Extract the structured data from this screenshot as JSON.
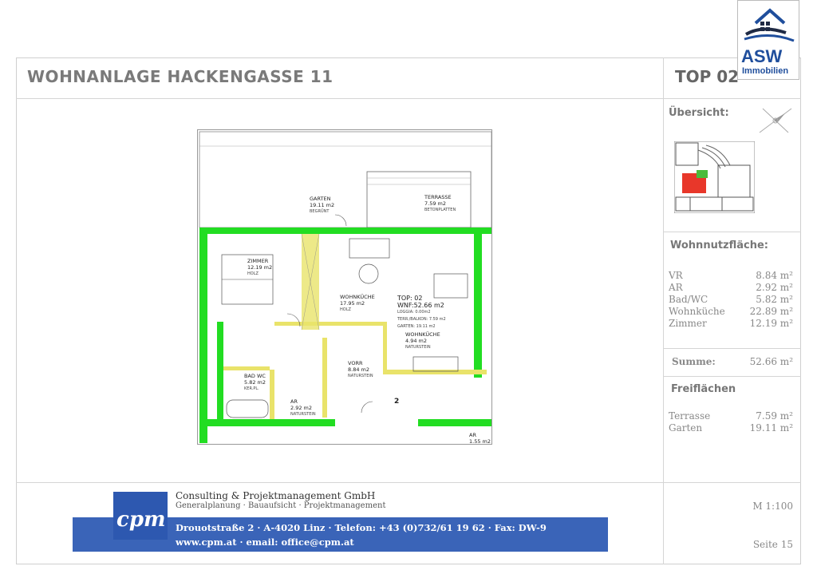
{
  "header": {
    "title": "WOHNANLAGE HACKENGASSE 11",
    "unit": "TOP 02"
  },
  "logo": {
    "name": "ASW",
    "sub": "Immobilien"
  },
  "sidebar": {
    "overview_label": "Übersicht:",
    "area_heading": "Wohnnutzfläche:",
    "area_rows": [
      {
        "label": "VR",
        "value": "8.84 m²"
      },
      {
        "label": "AR",
        "value": "2.92 m²"
      },
      {
        "label": "Bad/WC",
        "value": "5.82 m²"
      },
      {
        "label": "Wohnküche",
        "value": "22.89 m²"
      },
      {
        "label": "Zimmer",
        "value": "12.19 m²"
      }
    ],
    "sum_label": "Summe:",
    "sum_value": "52.66 m²",
    "outdoor_heading": "Freiflächen",
    "outdoor_rows": [
      {
        "label": "Terrasse",
        "value": "7.59 m²"
      },
      {
        "label": "Garten",
        "value": "19.11 m²"
      }
    ],
    "scale": "M 1:100",
    "page": "Seite 15"
  },
  "plan": {
    "garten": {
      "name": "GARTEN",
      "area": "19.11 m2",
      "floor": "BEGRÜNT"
    },
    "terrasse": {
      "name": "TERRASSE",
      "area": "7.59 m2",
      "floor": "BETONPLATTEN"
    },
    "zimmer": {
      "name": "ZIMMER",
      "area": "12.19 m2",
      "floor": "HOLZ"
    },
    "wohnkueche": {
      "name": "WOHNKÜCHE",
      "area": "17.95 m2",
      "floor": "HOLZ"
    },
    "kueche": {
      "name": "WOHNKÜCHE",
      "area": "4.94 m2",
      "floor": "NATURSTEIN"
    },
    "top": {
      "name": "TOP: 02",
      "wnf": "WNF:52.66 m2",
      "loggia": "LOGGIA:  0.00m2",
      "terr": "TERR./BALKON:  7.59 m2",
      "garten": "GARTEN: 19.11 m2"
    },
    "bad": {
      "name": "BAD WC",
      "area": "5.82 m2",
      "floor": "KER.PL."
    },
    "vorr": {
      "name": "VORR",
      "area": "8.84 m2",
      "floor": "NATURSTEIN"
    },
    "ar": {
      "name": "AR",
      "area": "2.92 m2",
      "floor": "NATURSTEIN"
    },
    "ar2": {
      "name": "AR",
      "area": "1.55 m2"
    },
    "stair": "2"
  },
  "footer": {
    "company": "Consulting & Projektmanagement GmbH",
    "services": "Generalplanung · Bauaufsicht · Projektmanagement",
    "address": "Drouotstraße 2 · A-4020 Linz · Telefon: +43 (0)732/61 19 62 · Fax: DW-9",
    "web": "www.cpm.at · email: office@cpm.at",
    "logo_text": "cpm"
  },
  "colors": {
    "wall": "#22dd22",
    "accent": "#1f4e9c",
    "highlight": "#e8372a",
    "bar": "#3a64b8",
    "floor_yellow": "#e9e36a"
  }
}
